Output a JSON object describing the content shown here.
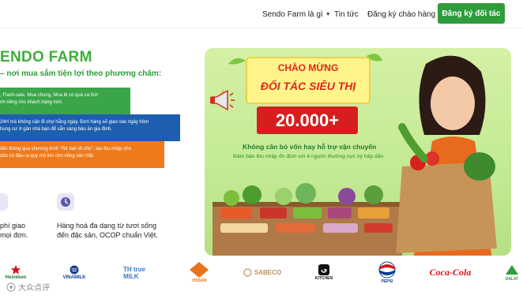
{
  "nav": {
    "items": [
      {
        "label": "Sendo Farm là gì",
        "has_dropdown": true
      },
      {
        "label": "Tin tức"
      },
      {
        "label": "Đăng ký chào hàng"
      }
    ],
    "cta": "Đăng ký đối tác"
  },
  "hero": {
    "brand": "ENDO FARM",
    "tagline": "– nơi mua sắm tiện lợi theo phương châm:",
    "benefits": [
      {
        "lines": [
          ", Flash-sale, Mua chung, Mua lẻ có quà và tích",
          "nh riêng cho khách hàng mới."
        ],
        "color": "#3aa54a"
      },
      {
        "lines": [
          "24H mà không cần đi chợ hằng ngày. Đơn hàng sẽ giao vào ngày hôm",
          "hung cư ở gần nhà bạn để sẵn sàng bảo ăn gia đình."
        ],
        "color": "#1d5fae"
      },
      {
        "lines": [
          "tiền thông qua chương trình \"Rẻ bạn đi chợ\", tạo thu nhập cho",
          "dân có đầu ra quy mô lớn cho nông sản Việt."
        ],
        "color": "#ee7a1c"
      }
    ],
    "features": [
      {
        "line1": "phí giao",
        "line2": "mọi đơn."
      },
      {
        "line1": "Hàng hoá đa dạng từ tươi sống",
        "line2": "đến đặc sản, OCOP chuẩn Việt.",
        "icon": "clock-icon"
      }
    ]
  },
  "banner": {
    "sign_line1": "CHÀO MỪNG",
    "sign_line2": "ĐỐI TÁC SIÊU THỊ",
    "number": "20.000+",
    "headline": "Không cần bỏ vốn hay hỗ trợ vận chuyển",
    "subline": "Đảm bảo thu nhập ổn định với 4 nguồn thưởng cực kỳ hấp dẫn"
  },
  "partners": [
    {
      "name": "Heineken",
      "color": "#1b7a34"
    },
    {
      "name": "VINAMILK",
      "color": "#1a3f8c"
    },
    {
      "name": "TH true MILK",
      "color": "#3a7bc8"
    },
    {
      "name": "VISSAN",
      "color": "#e8731c"
    },
    {
      "name": "SABECO",
      "color": "#b8935a"
    },
    {
      "name": "KITCHEN",
      "color": "#111111"
    },
    {
      "name": "PEPSI",
      "color": "#0a3c8c"
    },
    {
      "name": "Coca-Cola",
      "color": "#d8141c"
    },
    {
      "name": "DALAT",
      "color": "#2e9c3a"
    }
  ],
  "watermark": "大众点评",
  "colors": {
    "brand_green": "#3fae3a",
    "cta_green": "#2e9c3a",
    "ribbon_red": "#d71e1e"
  }
}
